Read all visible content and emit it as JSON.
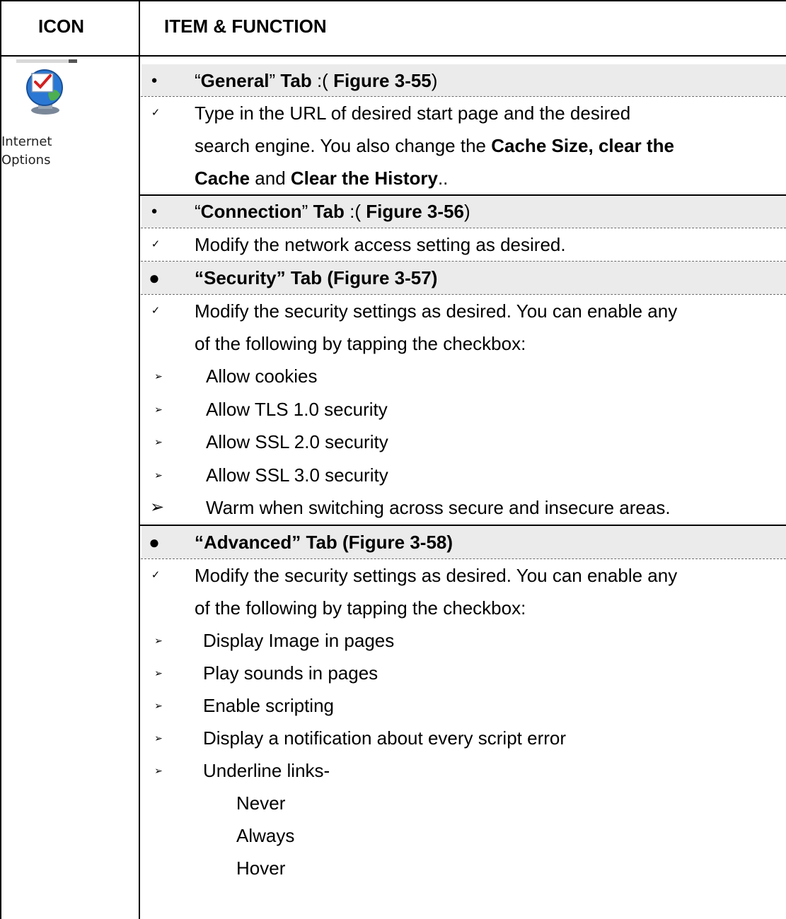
{
  "table": {
    "col_icon_header": "ICON",
    "col_item_header": "ITEM & FUNCTION"
  },
  "icon": {
    "name": "internet-options-icon",
    "label_line1": "Internet",
    "label_line2": "Options"
  },
  "general": {
    "q_open": "“",
    "tab_name": "General",
    "q_close": "”",
    "tab_word": "Tab",
    "paren_open": ":(",
    "figure": "Figure 3-55",
    "paren_close": ")",
    "desc_line1": "Type in the URL of desired start page and the desired",
    "desc_line2_a": "search engine. You also change the ",
    "desc_line2_b": "Cache Size, clear the",
    "desc_line3_a": "Cache",
    "desc_line3_b": " and ",
    "desc_line3_c": "Clear the History",
    "desc_line3_d": ".."
  },
  "connection": {
    "q_open": "“",
    "tab_name": "Connection",
    "q_close": "”",
    "tab_word": "Tab",
    "paren_open": ":(",
    "figure": "Figure 3-56",
    "paren_close": ")",
    "desc": "Modify the network access setting as desired."
  },
  "security": {
    "heading": "“Security” Tab (Figure 3-57)",
    "desc_line1": "Modify the security settings as desired. You can enable any",
    "desc_line2": "of the following by tapping the checkbox:",
    "options": [
      "Allow cookies",
      "Allow TLS 1.0 security",
      "Allow SSL 2.0 security",
      "Allow SSL 3.0 security",
      "Warm when switching across secure and insecure areas."
    ]
  },
  "advanced": {
    "heading": "“Advanced” Tab (Figure 3-58)",
    "desc_line1": "Modify the security settings as desired. You can enable any",
    "desc_line2": "of the following by tapping the checkbox:",
    "options": [
      "Display Image in pages",
      "Play sounds in pages",
      "Enable scripting",
      "Display a notification about every script error",
      "Underline links-"
    ],
    "underline_choices": [
      "Never",
      "Always",
      "Hover"
    ]
  },
  "markers": {
    "bullet": "●",
    "check": "✓",
    "arrow": "➢"
  }
}
